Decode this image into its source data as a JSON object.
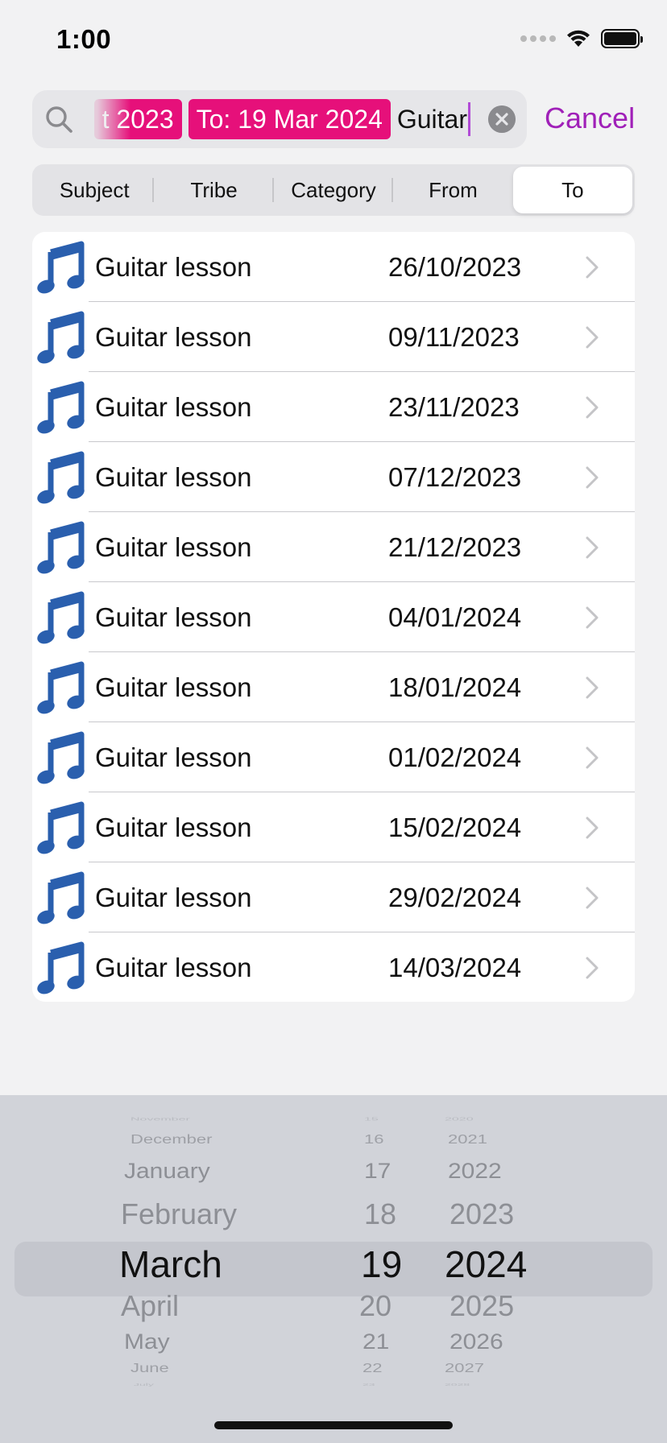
{
  "status_bar": {
    "time": "1:00"
  },
  "search": {
    "tokens": [
      "t 2023",
      "To: 19 Mar 2024"
    ],
    "query": "Guitar",
    "cancel_label": "Cancel"
  },
  "scopes": [
    {
      "label": "Subject",
      "active": false
    },
    {
      "label": "Tribe",
      "active": false
    },
    {
      "label": "Category",
      "active": false
    },
    {
      "label": "From",
      "active": false
    },
    {
      "label": "To",
      "active": true
    }
  ],
  "results": [
    {
      "subject": "Guitar lesson",
      "date": "26/10/2023"
    },
    {
      "subject": "Guitar lesson",
      "date": "09/11/2023"
    },
    {
      "subject": "Guitar lesson",
      "date": "23/11/2023"
    },
    {
      "subject": "Guitar lesson",
      "date": "07/12/2023"
    },
    {
      "subject": "Guitar lesson",
      "date": "21/12/2023"
    },
    {
      "subject": "Guitar lesson",
      "date": "04/01/2024"
    },
    {
      "subject": "Guitar lesson",
      "date": "18/01/2024"
    },
    {
      "subject": "Guitar lesson",
      "date": "01/02/2024"
    },
    {
      "subject": "Guitar lesson",
      "date": "15/02/2024"
    },
    {
      "subject": "Guitar lesson",
      "date": "29/02/2024"
    },
    {
      "subject": "Guitar lesson",
      "date": "14/03/2024"
    }
  ],
  "date_picker": {
    "months": [
      "November",
      "December",
      "January",
      "February",
      "March",
      "April",
      "May",
      "June",
      "July"
    ],
    "days": [
      "15",
      "16",
      "17",
      "18",
      "19",
      "20",
      "21",
      "22",
      "23"
    ],
    "years": [
      "2020",
      "2021",
      "2022",
      "2023",
      "2024",
      "2025",
      "2026",
      "2027",
      "2028"
    ],
    "selected": {
      "month": "March",
      "day": "19",
      "year": "2024"
    }
  },
  "colors": {
    "accent": "#a020b8",
    "token": "#e6107a",
    "note_icon": "#2a5fae"
  },
  "icons": {
    "row_icon": "music-note-icon",
    "search": "magnifier-icon",
    "clear": "x-circle-icon",
    "chevron": "chevron-right-icon"
  }
}
